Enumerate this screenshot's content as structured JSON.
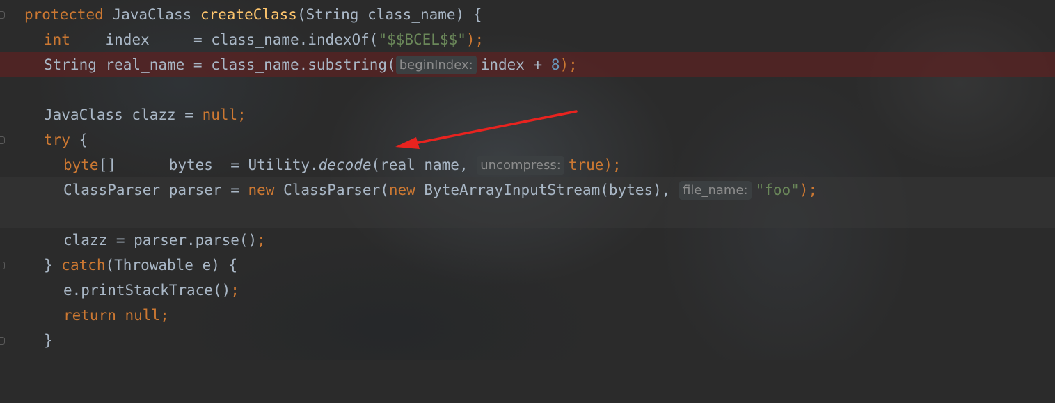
{
  "editor": {
    "lines": [
      {
        "parts": [
          "protected",
          " JavaClass ",
          "createClass",
          "(String class_name) {"
        ]
      },
      {
        "parts": [
          "int",
          "    index     = class_name.indexOf(",
          "\"$$BCEL$$\"",
          ");"
        ]
      },
      {
        "parts": [
          "String real_name = class_name.substring(",
          "beginIndex:",
          "index + ",
          "8",
          ");"
        ]
      },
      {
        "parts": []
      },
      {
        "parts": [
          "JavaClass clazz = ",
          "null",
          ";"
        ]
      },
      {
        "parts": [
          "try",
          " {"
        ]
      },
      {
        "parts": [
          "byte",
          "[]      bytes  = Utility.",
          "decode",
          "(real_name, ",
          "uncompress:",
          "true",
          ");"
        ]
      },
      {
        "parts": [
          "ClassParser parser = ",
          "new",
          " ClassParser(",
          "new",
          " ByteArrayInputStream(bytes), ",
          "file_name:",
          "\"foo\"",
          ");"
        ]
      },
      {
        "parts": []
      },
      {
        "parts": [
          "clazz = parser.parse()",
          ";"
        ]
      },
      {
        "parts": [
          "} ",
          "catch",
          "(Throwable e) {"
        ]
      },
      {
        "parts": [
          "e.printStackTrace()",
          ";"
        ]
      },
      {
        "parts": [
          "return null",
          ";"
        ]
      },
      {
        "parts": [
          "}"
        ]
      }
    ]
  },
  "annotation": {
    "arrow_color": "#e8231f"
  },
  "colors": {
    "background": "#2b2b2b",
    "default_text": "#a9b7c6",
    "keyword": "#cc7832",
    "method_declaration": "#ffc66d",
    "string": "#6a8759",
    "number": "#6897bb",
    "inlay_hint_text": "#8c8c8c",
    "inlay_hint_bg": "#3b3f41",
    "breakpoint_line": "#582323"
  }
}
